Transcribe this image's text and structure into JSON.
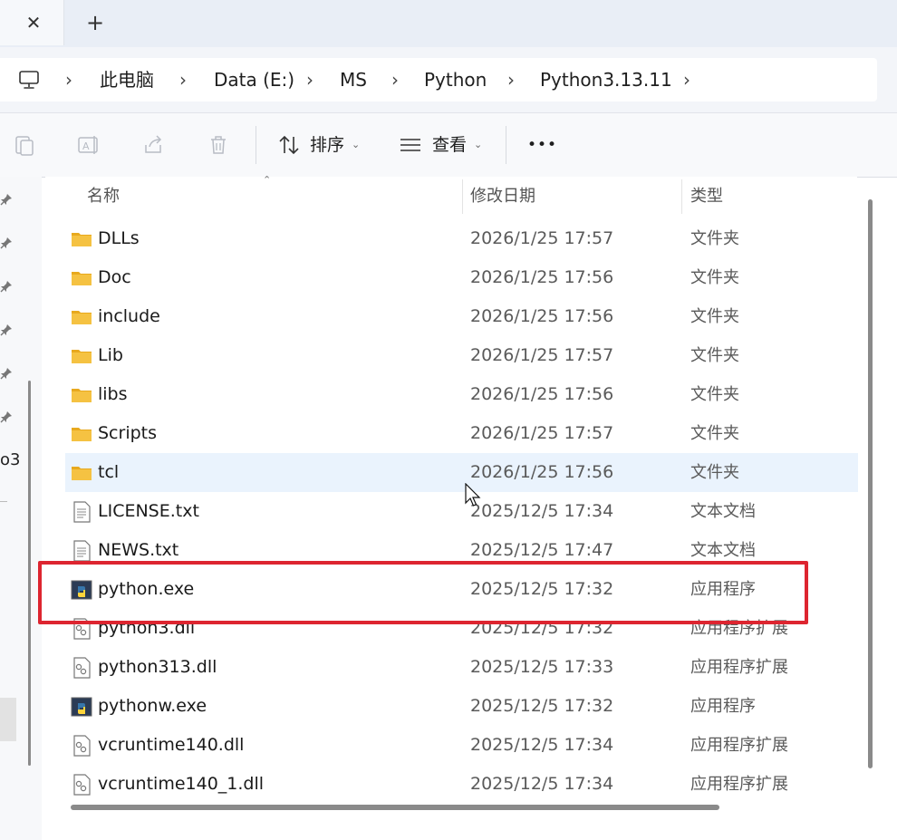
{
  "tabs": {
    "close_symbol": "✕",
    "new_tab_symbol": "+"
  },
  "breadcrumb": {
    "separator": "›",
    "items": [
      "此电脑",
      "Data (E:)",
      "MS",
      "Python",
      "Python3.13.11"
    ]
  },
  "toolbar": {
    "sort_label": "排序",
    "view_label": "查看",
    "more_label": "•••",
    "caret": "⌄"
  },
  "left_pane": {
    "truncated_text": "o3"
  },
  "columns": {
    "name": "名称",
    "date": "修改日期",
    "type": "类型",
    "sort_indicator": "⌃"
  },
  "files": [
    {
      "name": "DLLs",
      "date": "2026/1/25 17:57",
      "type": "文件夹",
      "icon": "folder-icon"
    },
    {
      "name": "Doc",
      "date": "2026/1/25 17:56",
      "type": "文件夹",
      "icon": "folder-icon"
    },
    {
      "name": "include",
      "date": "2026/1/25 17:56",
      "type": "文件夹",
      "icon": "folder-icon"
    },
    {
      "name": "Lib",
      "date": "2026/1/25 17:57",
      "type": "文件夹",
      "icon": "folder-icon"
    },
    {
      "name": "libs",
      "date": "2026/1/25 17:56",
      "type": "文件夹",
      "icon": "folder-icon"
    },
    {
      "name": "Scripts",
      "date": "2026/1/25 17:57",
      "type": "文件夹",
      "icon": "folder-icon"
    },
    {
      "name": "tcl",
      "date": "2026/1/25 17:56",
      "type": "文件夹",
      "icon": "folder-icon"
    },
    {
      "name": "LICENSE.txt",
      "date": "2025/12/5 17:34",
      "type": "文本文档",
      "icon": "text-file-icon"
    },
    {
      "name": "NEWS.txt",
      "date": "2025/12/5 17:47",
      "type": "文本文档",
      "icon": "text-file-icon"
    },
    {
      "name": "python.exe",
      "date": "2025/12/5 17:32",
      "type": "应用程序",
      "icon": "python-exe-icon"
    },
    {
      "name": "python3.dll",
      "date": "2025/12/5 17:32",
      "type": "应用程序扩展",
      "icon": "dll-file-icon"
    },
    {
      "name": "python313.dll",
      "date": "2025/12/5 17:33",
      "type": "应用程序扩展",
      "icon": "dll-file-icon"
    },
    {
      "name": "pythonw.exe",
      "date": "2025/12/5 17:32",
      "type": "应用程序",
      "icon": "python-exe-icon"
    },
    {
      "name": "vcruntime140.dll",
      "date": "2025/12/5 17:34",
      "type": "应用程序扩展",
      "icon": "dll-file-icon"
    },
    {
      "name": "vcruntime140_1.dll",
      "date": "2025/12/5 17:34",
      "type": "应用程序扩展",
      "icon": "dll-file-icon"
    }
  ],
  "hovered_row": "tcl",
  "highlighted_row": "python.exe",
  "colors": {
    "highlight_border": "#dd2530",
    "hover_bg": "#eaf3fd",
    "folder": "#f5c242"
  }
}
